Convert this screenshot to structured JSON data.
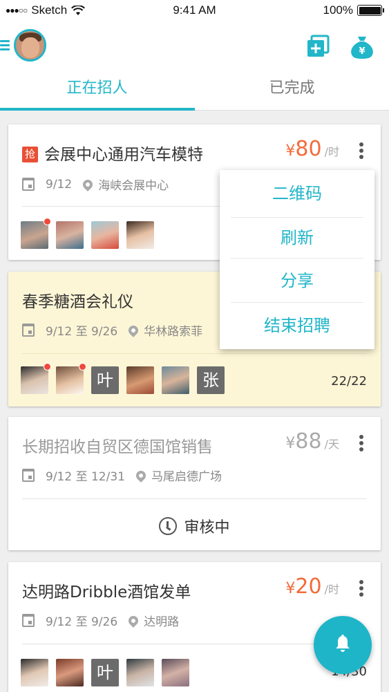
{
  "status_bar": {
    "signal": "●●●○○",
    "carrier": "Sketch",
    "time": "9:41 AM",
    "battery": "100%"
  },
  "tabs": [
    {
      "label": "正在招人",
      "active": true
    },
    {
      "label": "已完成",
      "active": false
    }
  ],
  "cards": [
    {
      "tag": "抢",
      "title": "会展中心通用汽车模特",
      "price": {
        "currency": "¥",
        "amount": "80",
        "unit": "/时"
      },
      "date": "9/12",
      "location": "海峡会展中心"
    },
    {
      "title": "春季糖酒会礼仪",
      "date": "9/12 至 9/26",
      "location": "华林路索菲",
      "avatar_letters": [
        "叶",
        "张"
      ],
      "count": "22/22"
    },
    {
      "title": "长期招收自贸区德国馆销售",
      "price": {
        "currency": "¥",
        "amount": "88",
        "unit": "/天"
      },
      "date": "9/12 至 12/31",
      "location": "马尾启德广场",
      "status": "审核中"
    },
    {
      "title": "达明路Dribble酒馆发单",
      "price": {
        "currency": "¥",
        "amount": "20",
        "unit": "/时"
      },
      "date": "9/12 至 9/26",
      "location": "达明路",
      "avatar_letters": [
        "叶"
      ],
      "count": "14/30"
    }
  ],
  "dropdown_menu": [
    "二维码",
    "刷新",
    "分享",
    "结束招聘"
  ],
  "colors": {
    "accent": "#21b6c9",
    "price": "#f26b3a",
    "highlight_card": "#fdf6d6",
    "notification_dot": "#f04a3c"
  }
}
